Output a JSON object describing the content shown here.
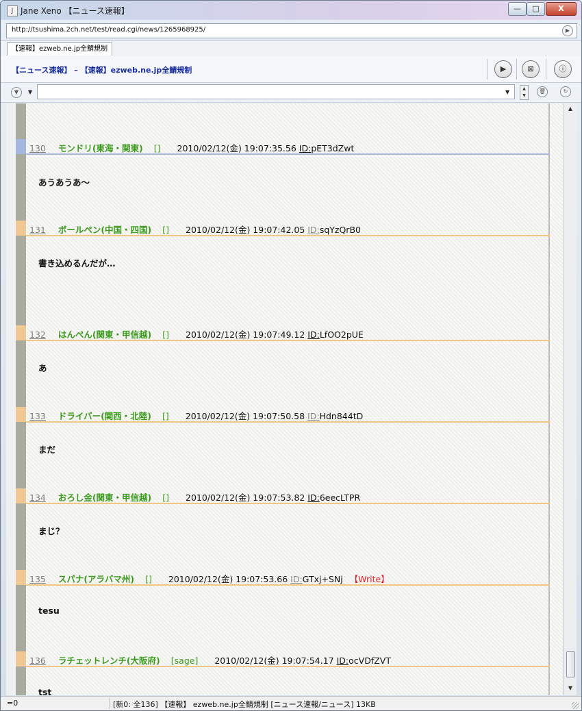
{
  "window": {
    "title": "Jane Xeno 【ニュース速報】",
    "minimize_label": "—",
    "maximize_label": "□",
    "close_label": "X"
  },
  "address": {
    "url": "http://tsushima.2ch.net/test/read.cgi/news/1265968925/"
  },
  "tab": {
    "label": "【速報】ezweb.ne.jp全鯖規制"
  },
  "thread": {
    "title": "【ニュース速報】 – 【速報】ezweb.ne.jp全鯖規制"
  },
  "search": {
    "value": ""
  },
  "posts": [
    {
      "num": "130",
      "name": "モンドリ(東海・関東)",
      "mail": "[]",
      "date": "2010/02/12(金) 19:07:35.56",
      "id_label": "ID:",
      "id": "pET3dZwt",
      "body": "あうあうあ〜",
      "write": ""
    },
    {
      "num": "131",
      "name": "ボールペン(中国・四国)",
      "mail": "[]",
      "date": "2010/02/12(金) 19:07:42.05",
      "id_label": "ID:",
      "id": "sqYzQrB0",
      "body": "書き込めるんだが…",
      "write": ""
    },
    {
      "num": "132",
      "name": "はんぺん(関東・甲信越)",
      "mail": "[]",
      "date": "2010/02/12(金) 19:07:49.12",
      "id_label": "ID:",
      "id": "LfOO2pUE",
      "body": "あ",
      "write": ""
    },
    {
      "num": "133",
      "name": "ドライバー(関西・北陸)",
      "mail": "[]",
      "date": "2010/02/12(金) 19:07:50.58",
      "id_label": "ID:",
      "id": "Hdn844tD",
      "body": "まだ",
      "write": ""
    },
    {
      "num": "134",
      "name": "おろし金(関東・甲信越)",
      "mail": "[]",
      "date": "2010/02/12(金) 19:07:53.82",
      "id_label": "ID:",
      "id": "6eecLTPR",
      "body": "まじ？",
      "write": ""
    },
    {
      "num": "135",
      "name": "スパナ(アラバマ州)",
      "mail": "[]",
      "date": "2010/02/12(金) 19:07:53.66",
      "id_label": "ID:",
      "id": "GTxj+SNj",
      "body": "tesu",
      "write": "【Write】"
    },
    {
      "num": "136",
      "name": "ラチェットレンチ(大阪府)",
      "mail": "[sage]",
      "date": "2010/02/12(金) 19:07:54.17",
      "id_label": "ID:",
      "id": "ocVDfZVT",
      "body": "tst",
      "write": ""
    }
  ],
  "status": {
    "left": "=0",
    "main": "[新0: 全136] 【速報】 ezweb.ne.jp全鯖規制 [ニュース速報/ニュース] 13KB"
  },
  "colors": {
    "name": "#3c9a1f",
    "header_line": "#f2c786",
    "write": "#e0202a",
    "thread_title": "#1a2fa0"
  }
}
